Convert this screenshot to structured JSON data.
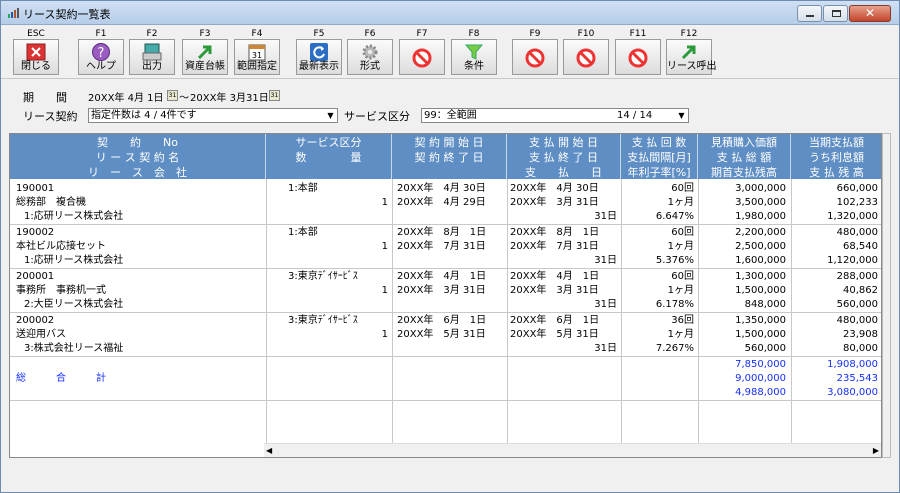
{
  "window": {
    "title": "リース契約一覧表"
  },
  "toolbar": {
    "buttons": [
      {
        "key": "ESC",
        "label": "閉じる"
      },
      {
        "key": "F1",
        "label": "ヘルプ"
      },
      {
        "key": "F2",
        "label": "出力"
      },
      {
        "key": "F3",
        "label": "資産台帳"
      },
      {
        "key": "F4",
        "label": "範囲指定"
      },
      {
        "key": "F5",
        "label": "最新表示"
      },
      {
        "key": "F6",
        "label": "形式"
      },
      {
        "key": "F7",
        "label": ""
      },
      {
        "key": "F8",
        "label": "条件"
      },
      {
        "key": "F9",
        "label": ""
      },
      {
        "key": "F10",
        "label": ""
      },
      {
        "key": "F11",
        "label": ""
      },
      {
        "key": "F12",
        "label": "リース呼出"
      }
    ]
  },
  "filters": {
    "period_label": "期　　間",
    "period_from": "20XX年 4月 1日",
    "period_sep": "～",
    "period_to": "20XX年 3月31日",
    "lease_label": "リース契約",
    "lease_value": "指定件数は 4 / 4件です",
    "service_label": "サービス区分",
    "service_value": "99：全範囲",
    "service_count": "14 / 14"
  },
  "headers": [
    {
      "l1": "契　　約　　No",
      "l2": "リ ー ス 契 約 名",
      "l3": "リ　ー　ス　会　社"
    },
    {
      "l1": "サービス区分",
      "l2": "数　　　　量",
      "l3": ""
    },
    {
      "l1": "契 約 開 始 日",
      "l2": "契 約 終 了 日",
      "l3": ""
    },
    {
      "l1": "支 払 開 始 日",
      "l2": "支 払 終 了 日",
      "l3": "支　　払　　日"
    },
    {
      "l1": "支 払 回 数",
      "l2": "支払間隔[月]",
      "l3": "年利子率[%]"
    },
    {
      "l1": "見積購入価額",
      "l2": "支 払 総 額",
      "l3": "期首支払残高"
    },
    {
      "l1": "当期支払額",
      "l2": "うち利息額",
      "l3": "支 払 残 高"
    }
  ],
  "rows": [
    {
      "no": "190001",
      "name": "総務部　複合機",
      "company": "1:応研リース株式会社",
      "service": "1:本部",
      "qty": "1",
      "cstart": "20XX年　4月 30日",
      "cend": "20XX年　4月 29日",
      "pstart": "20XX年　4月 30日",
      "pend": "20XX年　3月 31日",
      "pday": "31日",
      "count": "60回",
      "interval": "1ヶ月",
      "rate": "6.647%",
      "est": "3,000,000",
      "total": "3,500,000",
      "opening": "1,980,000",
      "cur": "660,000",
      "interest": "102,233",
      "remain": "1,320,000"
    },
    {
      "no": "190002",
      "name": "本社ビル応接セット",
      "company": "1:応研リース株式会社",
      "service": "1:本部",
      "qty": "1",
      "cstart": "20XX年　8月　1日",
      "cend": "20XX年　7月 31日",
      "pstart": "20XX年　8月　1日",
      "pend": "20XX年　7月 31日",
      "pday": "31日",
      "count": "60回",
      "interval": "1ヶ月",
      "rate": "5.376%",
      "est": "2,200,000",
      "total": "2,500,000",
      "opening": "1,600,000",
      "cur": "480,000",
      "interest": "68,540",
      "remain": "1,120,000"
    },
    {
      "no": "200001",
      "name": "事務所　事務机一式",
      "company": "2:大臣リース株式会社",
      "service": "3:東京ﾃﾞｲｻｰﾋﾞｽ",
      "qty": "1",
      "cstart": "20XX年　4月　1日",
      "cend": "20XX年　3月 31日",
      "pstart": "20XX年　4月　1日",
      "pend": "20XX年　3月 31日",
      "pday": "31日",
      "count": "60回",
      "interval": "1ヶ月",
      "rate": "6.178%",
      "est": "1,300,000",
      "total": "1,500,000",
      "opening": "848,000",
      "cur": "288,000",
      "interest": "40,862",
      "remain": "560,000"
    },
    {
      "no": "200002",
      "name": "送迎用バス",
      "company": "3:株式会社リース福祉",
      "service": "3:東京ﾃﾞｲｻｰﾋﾞｽ",
      "qty": "1",
      "cstart": "20XX年　6月　1日",
      "cend": "20XX年　5月 31日",
      "pstart": "20XX年　6月　1日",
      "pend": "20XX年　5月 31日",
      "pday": "31日",
      "count": "36回",
      "interval": "1ヶ月",
      "rate": "7.267%",
      "est": "1,350,000",
      "total": "1,500,000",
      "opening": "560,000",
      "cur": "480,000",
      "interest": "23,908",
      "remain": "80,000"
    }
  ],
  "totals": {
    "label": "総　　　合　　　計",
    "est": "7,850,000",
    "total": "9,000,000",
    "opening": "4,988,000",
    "cur": "1,908,000",
    "interest": "235,543",
    "remain": "3,080,000"
  }
}
